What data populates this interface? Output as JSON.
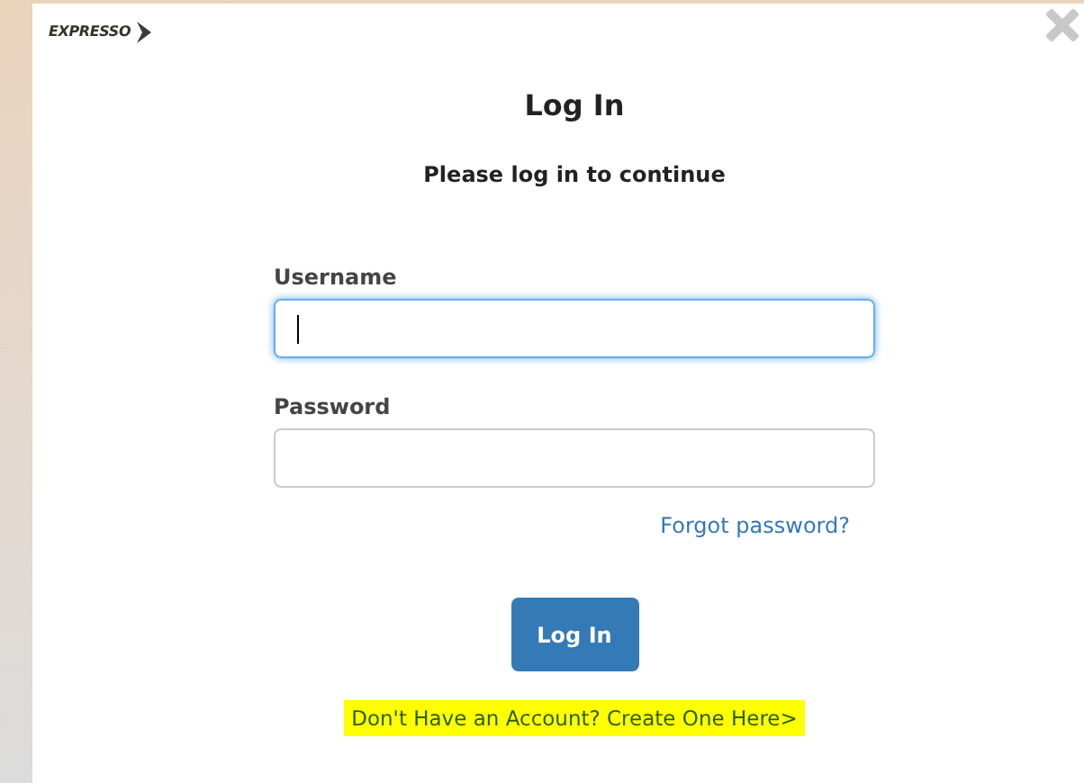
{
  "logo": {
    "text": "EXPRESSO"
  },
  "title": "Log In",
  "subtitle": "Please log in to continue",
  "fields": [
    {
      "label": "Username",
      "focused": true
    },
    {
      "label": "Password",
      "focused": false
    }
  ],
  "forgot_link": "Forgot password?",
  "submit_button": "Log In",
  "signup_link": {
    "text": "Don't Have an Account? Create One Here>",
    "highlighted": true
  }
}
